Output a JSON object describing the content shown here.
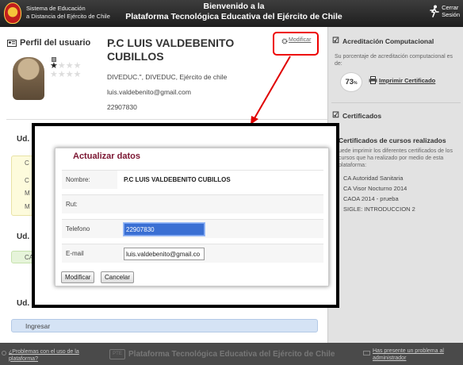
{
  "header": {
    "org_line1": "Sistema de Educación",
    "org_line2": "a Distancia del Ejército de Chile",
    "welcome_line1": "Bienvenido a la",
    "welcome_line2": "Plataforma Tecnológica Educativa del Ejército de Chile",
    "exit_line1": "Cerrar",
    "exit_line2": "Sesión",
    "logo_text": "SEADE"
  },
  "profile": {
    "section_title": "Perfil del usuario",
    "name_line1": "P.C LUIS VALDEBENITO",
    "name_line2": "CUBILLOS",
    "unit": "DIVEDUC.\", DIVEDUC, Ejército de chile",
    "email": "luis.valdebenito@gmail.com",
    "phone": "22907830",
    "modify_label": "Modificar",
    "stars_filled": 1,
    "stars_total": 5
  },
  "units": {
    "ud_label": "Ud.",
    "ingresar_label": "Ingresar",
    "yellow_items": [
      "C",
      "C",
      "M",
      "M"
    ],
    "green_item": "CA"
  },
  "accreditation": {
    "title": "Acreditación Computacional",
    "subtitle": "Su porcentaje de acreditación computacional es de:",
    "percent": "73",
    "percent_sign": "%",
    "print_label": "Imprimir Certificado"
  },
  "certificates": {
    "title": "Certificados",
    "courses_title": "Certificados de cursos realizados",
    "description": "uede imprimir los diferentes certificados de los cursos que ha realizado por medio de esta plataforma:",
    "items": [
      "CA Autoridad Sanitaria",
      "CA Visor Nocturno 2014",
      "CAOA 2014 - prueba",
      "SIGLE: INTRODUCCION 2"
    ]
  },
  "footer": {
    "problems_line1": "¿Problemas con el uso de la",
    "problems_line2": "plataforma?",
    "center": "Plataforma Tecnológica Educativa del Ejército de Chile",
    "center_logo": "PTE",
    "right_line1": "Has presente un problema al",
    "right_line2": "administrador"
  },
  "dialog": {
    "title": "Actualizar datos",
    "name_label": "Nombre:",
    "name_value": "P.C LUIS VALDEBENITO CUBILLOS",
    "rut_label": "Rut:",
    "phone_label": "Telefono",
    "phone_value": "22907830",
    "email_label": "E-mail",
    "email_value": "luis.valdebenito@gmail.co",
    "modify_button": "Modificar",
    "cancel_button": "Cancelar"
  },
  "colors": {
    "dialog_title": "#7b1531",
    "annotation_red": "#e00000",
    "header_bg": "#2b2b2b"
  }
}
